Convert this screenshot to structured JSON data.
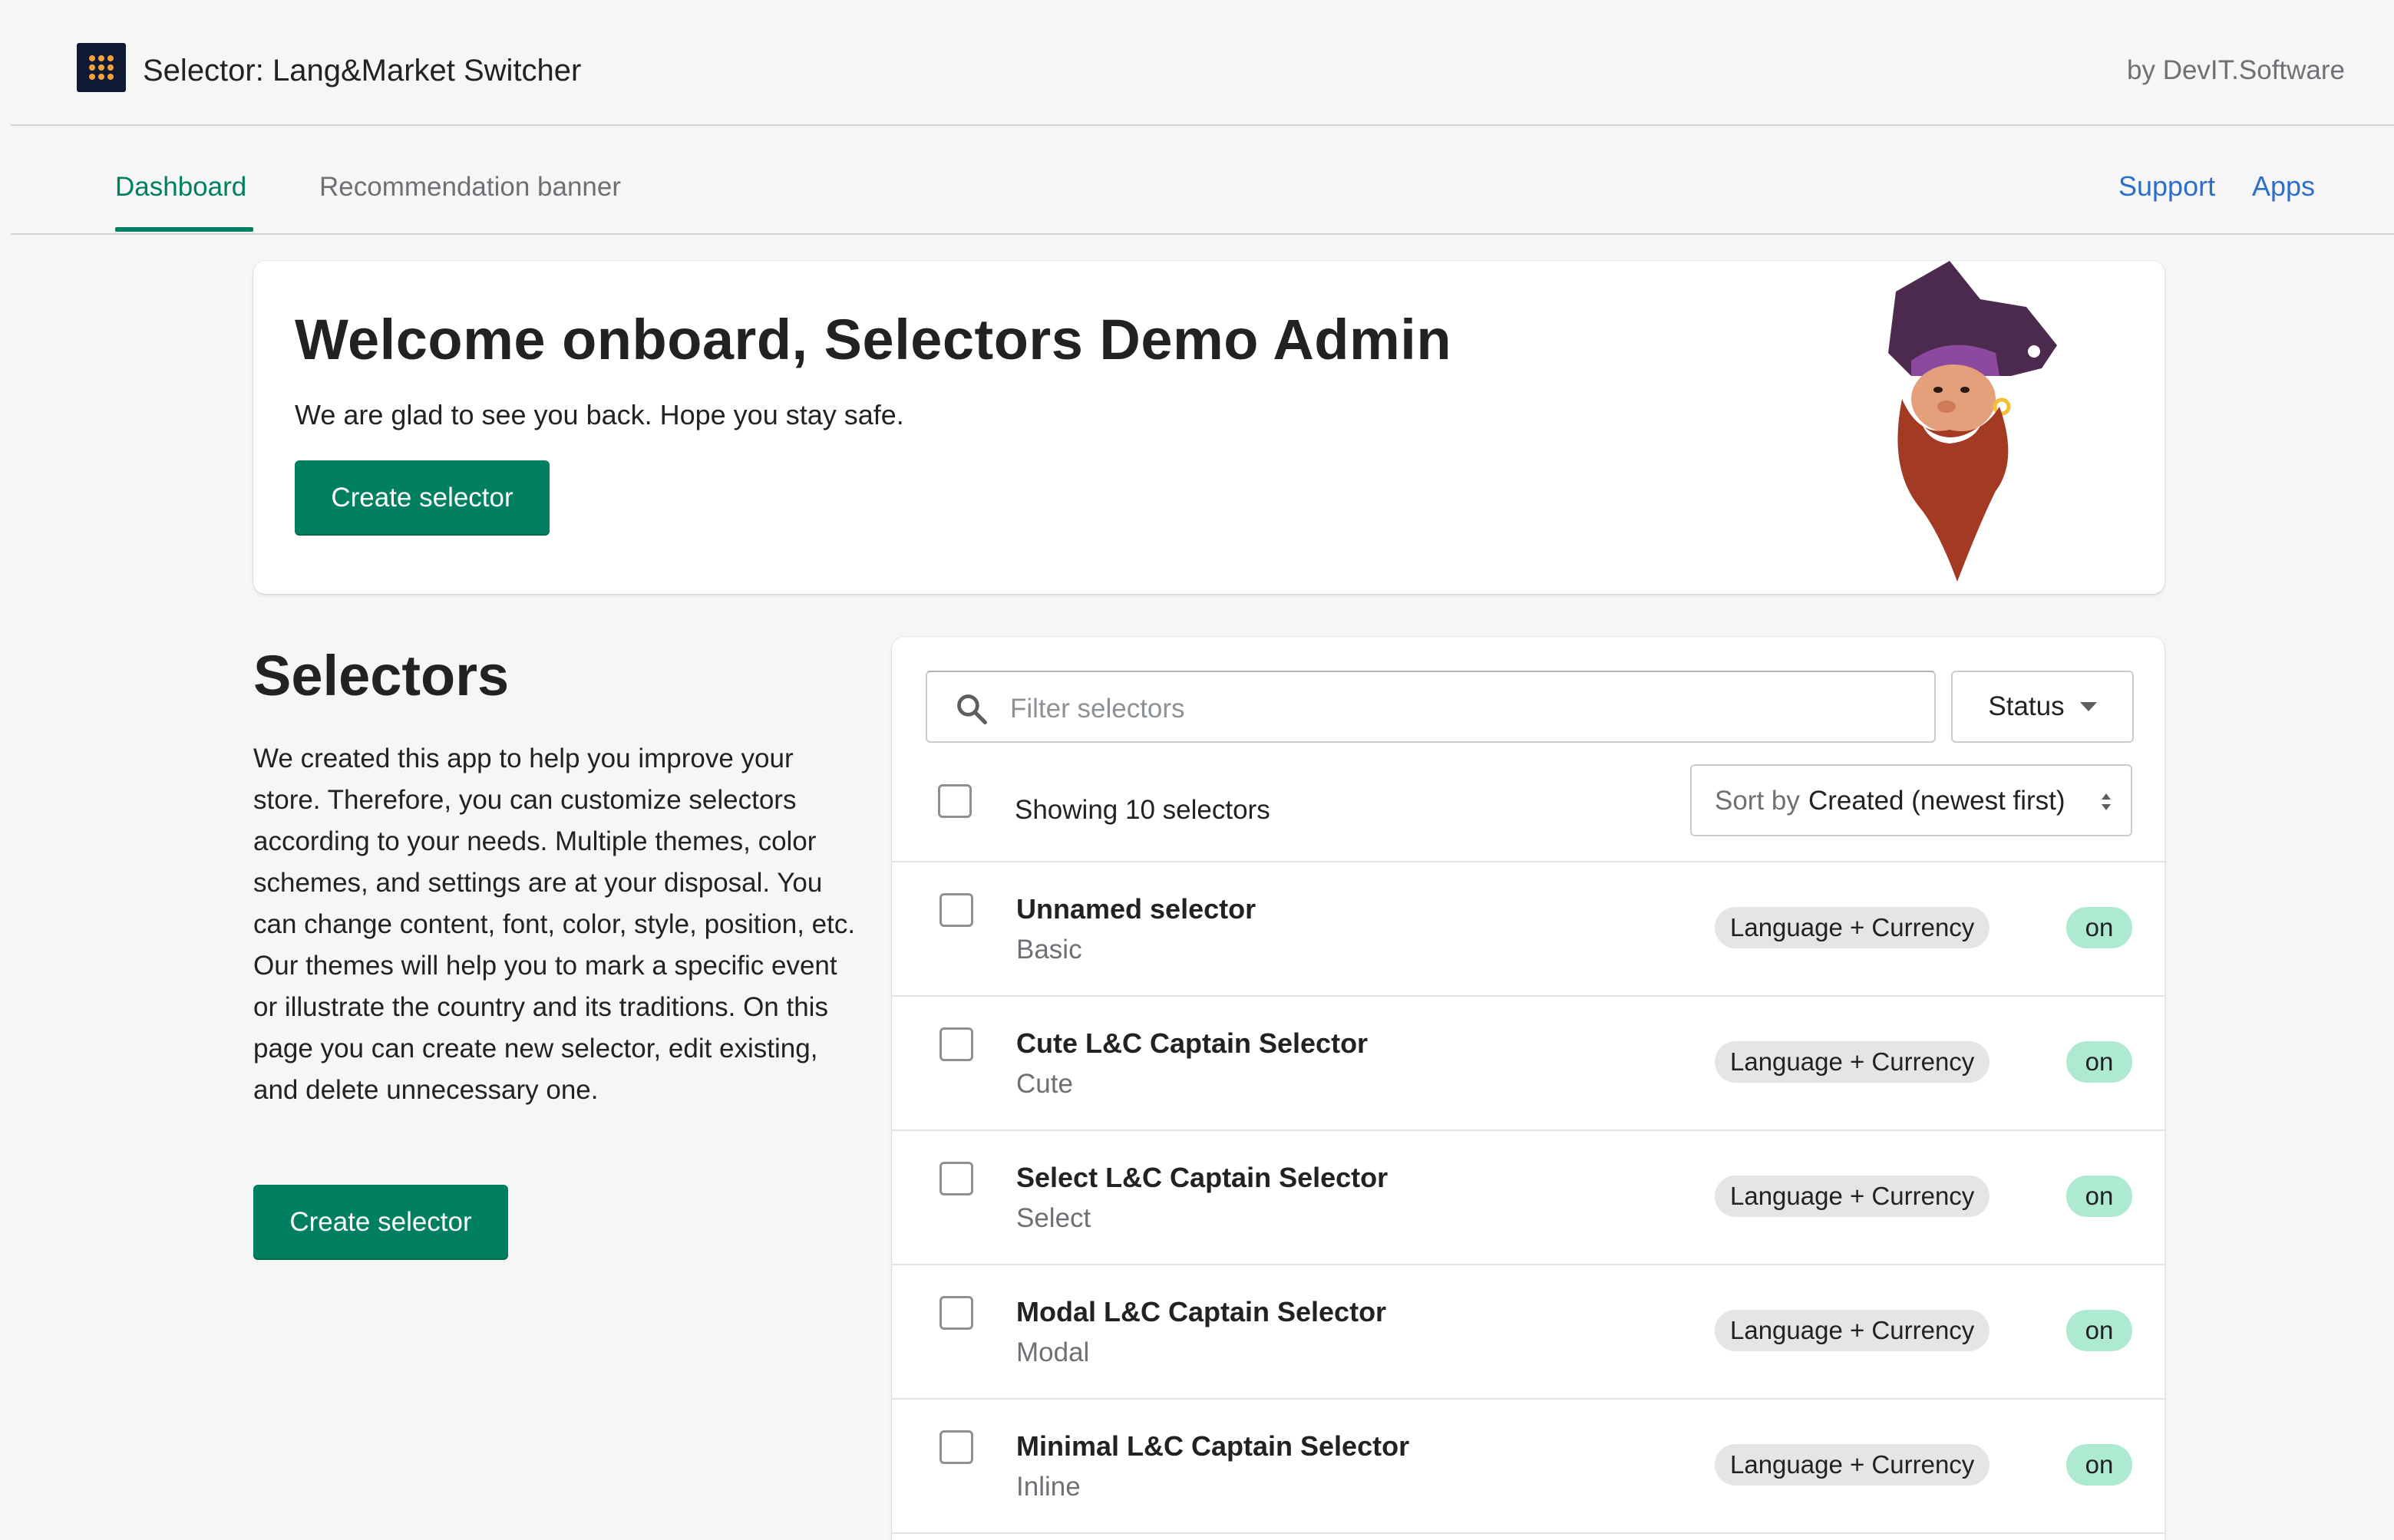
{
  "app": {
    "title": "Selector: Lang&Market Switcher",
    "by": "by DevIT.Software",
    "logo_icon": "app-logo-grid-icon"
  },
  "nav": {
    "tabs": [
      {
        "label": "Dashboard",
        "active": true
      },
      {
        "label": "Recommendation banner",
        "active": false
      }
    ],
    "links": {
      "support": "Support",
      "apps": "Apps"
    }
  },
  "welcome": {
    "title": "Welcome onboard, Selectors Demo Admin",
    "subtitle": "We are glad to see you back. Hope you stay safe.",
    "button": "Create selector",
    "illustration": "pirate-captain-mascot"
  },
  "selectors_section": {
    "title": "Selectors",
    "description": "We created this app to help you improve your store. Therefore, you can customize selectors according to your needs. Multiple themes, color schemes, and settings are at your disposal. You can change content, font, color, style, position, etc. Our themes will help you to mark a specific event or illustrate the country and its traditions. On this page you can create new selector, edit existing, and delete unnecessary one.",
    "button": "Create selector"
  },
  "list": {
    "filter_placeholder": "Filter selectors",
    "status_label": "Status",
    "showing": "Showing 10 selectors",
    "sort_label": "Sort by",
    "sort_value": "Created (newest first)",
    "rows": [
      {
        "name": "Unnamed selector",
        "theme": "Basic",
        "type": "Language + Currency",
        "status": "on"
      },
      {
        "name": "Cute L&C Captain Selector",
        "theme": "Cute",
        "type": "Language + Currency",
        "status": "on"
      },
      {
        "name": "Select L&C Captain Selector",
        "theme": "Select",
        "type": "Language + Currency",
        "status": "on"
      },
      {
        "name": "Modal L&C Captain Selector",
        "theme": "Modal",
        "type": "Language + Currency",
        "status": "on"
      },
      {
        "name": "Minimal L&C Captain Selector",
        "theme": "Inline",
        "type": "Language + Currency",
        "status": "on"
      }
    ]
  },
  "colors": {
    "primary": "#008060",
    "link": "#2c6ecb",
    "status_on": "#aee9d1",
    "badge": "#e4e5e7",
    "logo_bg": "#111a35"
  }
}
